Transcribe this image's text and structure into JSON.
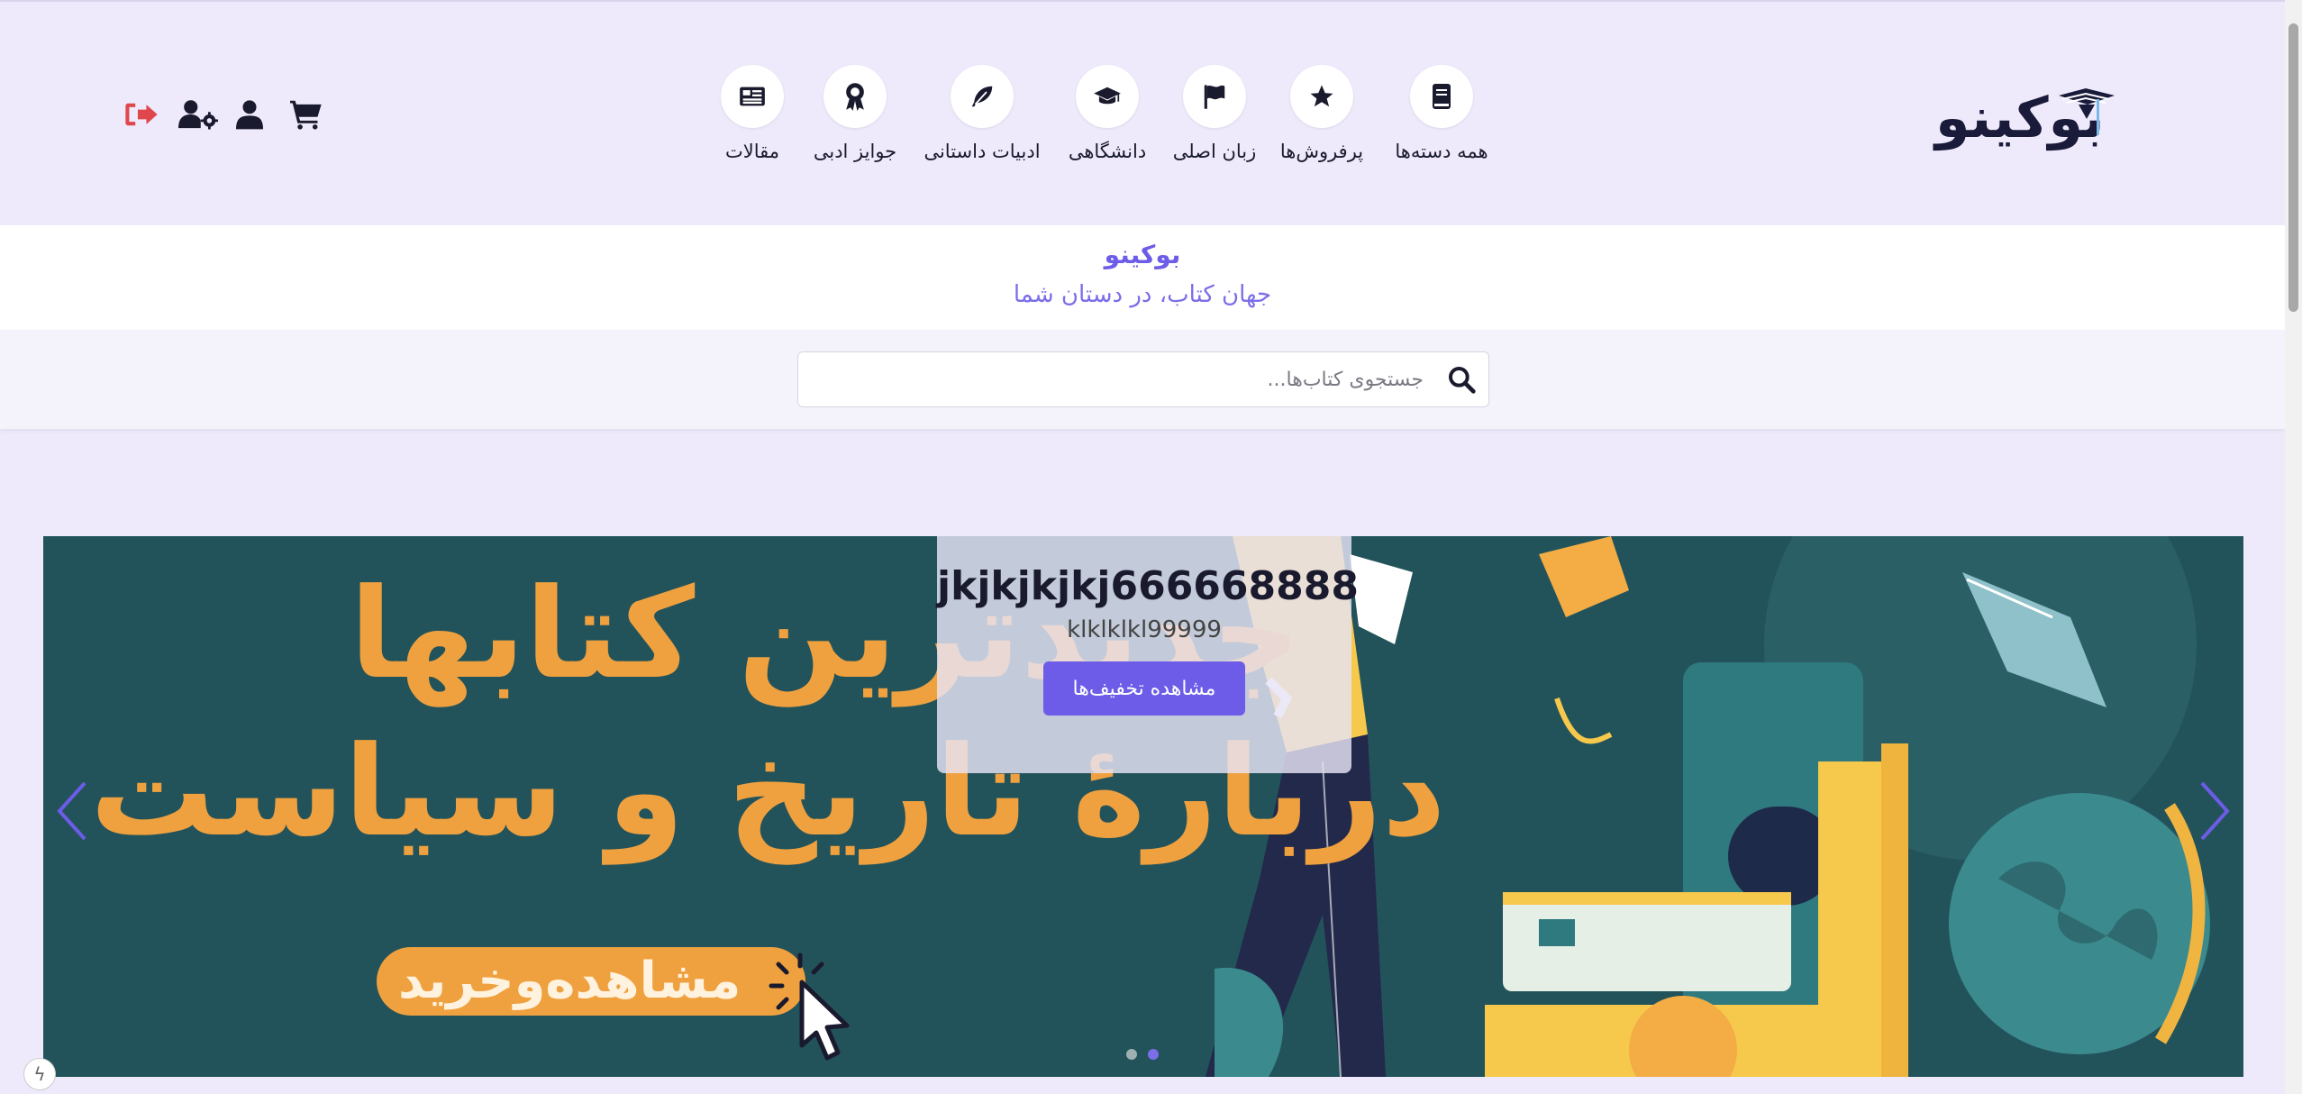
{
  "header": {
    "logo_text": "بوکینو",
    "nav": [
      {
        "label": "همه دسته‌ها",
        "icon": "book-icon"
      },
      {
        "label": "پرفروش‌ها",
        "icon": "star-icon"
      },
      {
        "label": "زبان اصلی",
        "icon": "flag-icon"
      },
      {
        "label": "دانشگاهی",
        "icon": "graduation-cap-icon"
      },
      {
        "label": "ادبیات داستانی",
        "icon": "feather-icon"
      },
      {
        "label": "جوایز ادبی",
        "icon": "award-icon"
      },
      {
        "label": "مقالات",
        "icon": "newspaper-icon"
      }
    ],
    "user_icons": [
      "cart-icon",
      "user-icon",
      "user-settings-icon",
      "logout-icon"
    ]
  },
  "brand": {
    "title": "بوکینو",
    "tagline": "جهان کتاب، در دستان شما"
  },
  "search": {
    "placeholder": "جستجوی کتاب‌ها..."
  },
  "carousel": {
    "banner_line_1": "جدیدترین کتابها",
    "banner_line_2": "دربارهٔ تاریخ و سیاست",
    "banner_button": "مشاهده‌وخرید",
    "caption_title": "jkjkjkjkj666668888",
    "caption_subtitle": "klklklkl99999",
    "caption_button": "مشاهده تخفیف‌ها",
    "slide_count": 2,
    "active_slide": 2
  },
  "colors": {
    "accent": "#6c5ce7",
    "banner_bg": "#23535a",
    "banner_text": "#f0a13f",
    "logout": "#e0474c"
  }
}
